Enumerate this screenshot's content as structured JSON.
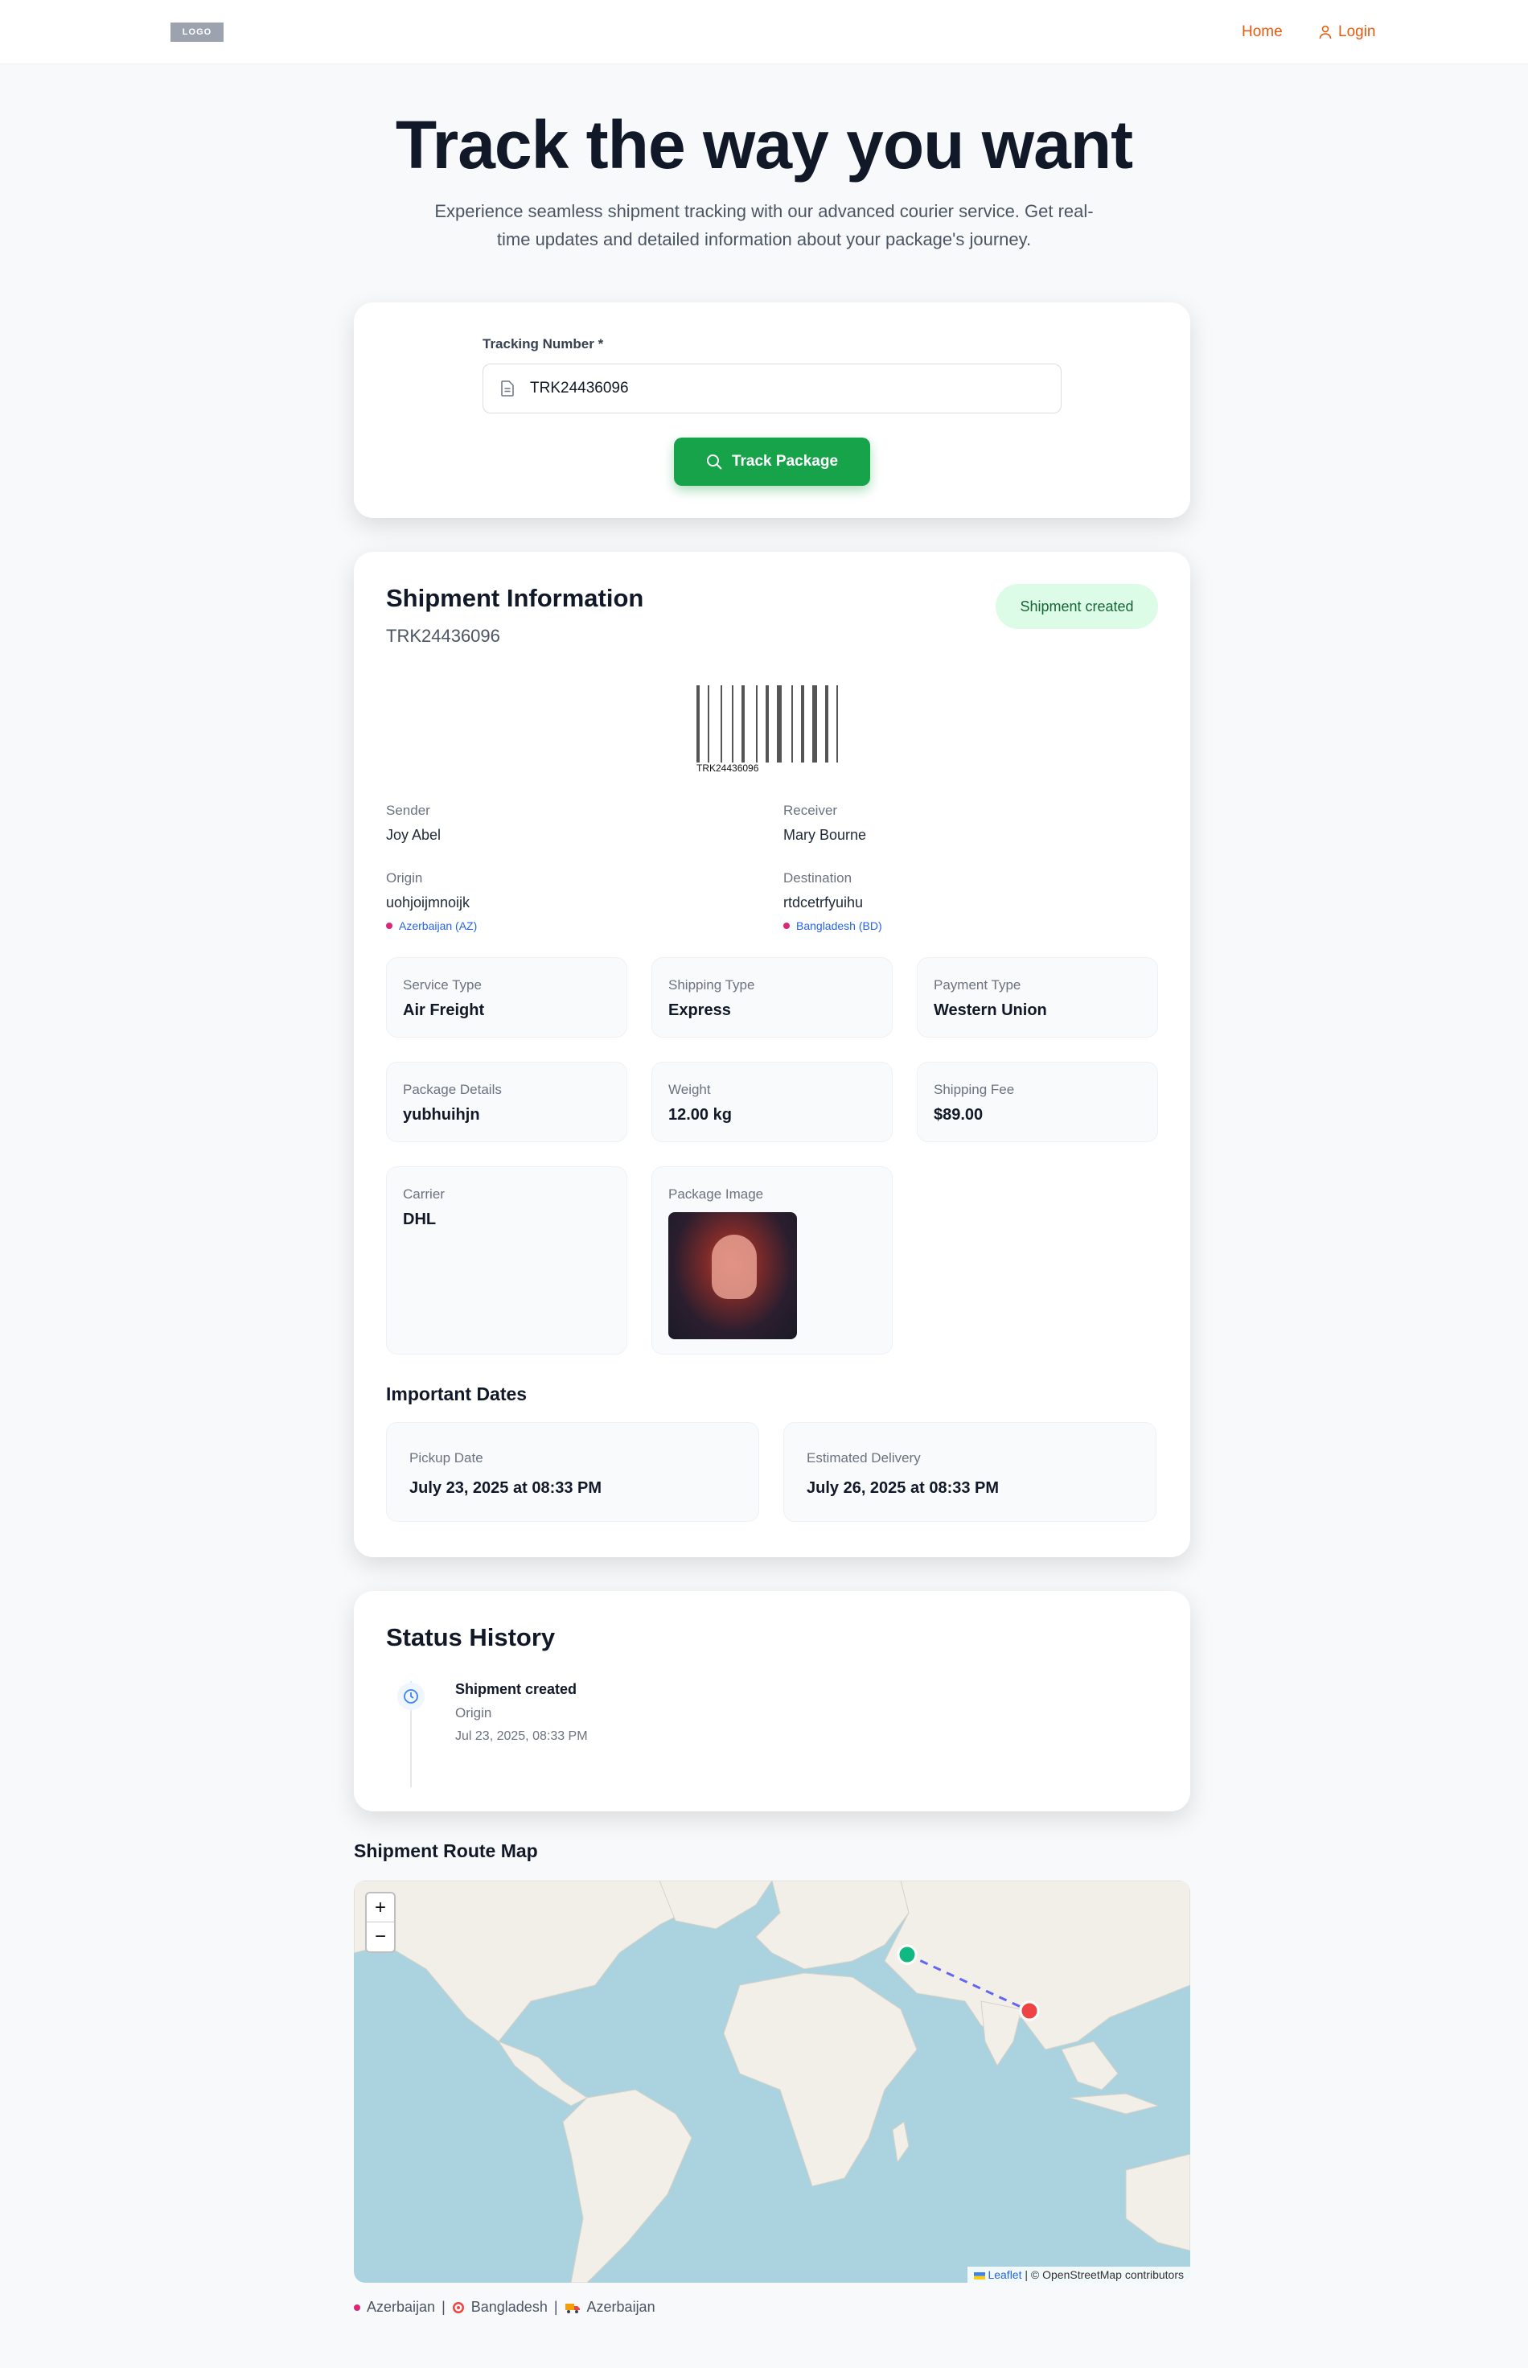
{
  "nav": {
    "logo": "LOGO",
    "home": "Home",
    "login": "Login"
  },
  "hero": {
    "title": "Track the way you want",
    "subtitle": "Experience seamless shipment tracking with our advanced courier service. Get real-time updates and detailed information about your package's journey."
  },
  "search": {
    "label": "Tracking Number *",
    "value": "TRK24436096",
    "button": "Track Package"
  },
  "shipment": {
    "title": "Shipment Information",
    "tracking": "TRK24436096",
    "status": "Shipment created",
    "barcode_text": "TRK24436096",
    "sender": {
      "label": "Sender",
      "value": "Joy Abel"
    },
    "receiver": {
      "label": "Receiver",
      "value": "Mary Bourne"
    },
    "origin": {
      "label": "Origin",
      "value": "uohjoijmnoijk",
      "country": "Azerbaijan (AZ)"
    },
    "destination": {
      "label": "Destination",
      "value": "rtdcetrfyuihu",
      "country": "Bangladesh (BD)"
    },
    "details": [
      {
        "label": "Service Type",
        "value": "Air Freight"
      },
      {
        "label": "Shipping Type",
        "value": "Express"
      },
      {
        "label": "Payment Type",
        "value": "Western Union"
      },
      {
        "label": "Package Details",
        "value": "yubhuihjn"
      },
      {
        "label": "Weight",
        "value": "12.00 kg"
      },
      {
        "label": "Shipping Fee",
        "value": "$89.00"
      },
      {
        "label": "Carrier",
        "value": "DHL"
      },
      {
        "label": "Package Image",
        "value": ""
      }
    ],
    "dates_title": "Important Dates",
    "pickup": {
      "label": "Pickup Date",
      "value": "July 23, 2025 at 08:33 PM"
    },
    "delivery": {
      "label": "Estimated Delivery",
      "value": "July 26, 2025 at 08:33 PM"
    }
  },
  "history": {
    "title": "Status History",
    "items": [
      {
        "status": "Shipment created",
        "location": "Origin",
        "time": "Jul 23, 2025, 08:33 PM"
      }
    ]
  },
  "map": {
    "title": "Shipment Route Map",
    "zoom_in": "+",
    "zoom_out": "−",
    "attribution_leaflet": "Leaflet",
    "attribution_rest": "| © OpenStreetMap contributors",
    "legend": {
      "origin": "Azerbaijan",
      "destination": "Bangladesh",
      "current": "Azerbaijan",
      "separator": "|"
    }
  },
  "colors": {
    "accent": "#ea580c",
    "button": "#16a34a",
    "badge_bg": "#dcfce7",
    "origin_marker": "#10b981",
    "destination_marker": "#ef4444"
  }
}
